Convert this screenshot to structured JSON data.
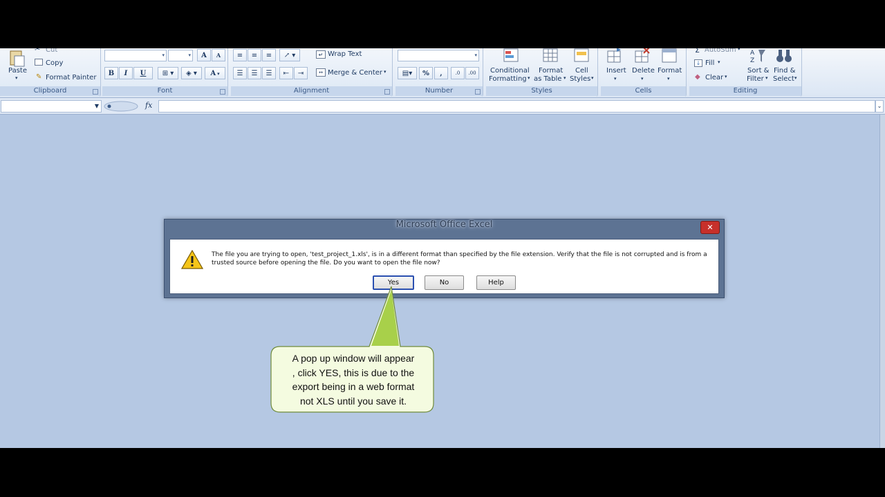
{
  "ribbon": {
    "clipboard": {
      "label": "Clipboard",
      "paste": "Paste",
      "cut": "Cut",
      "copy": "Copy",
      "format_painter": "Format Painter"
    },
    "font": {
      "label": "Font",
      "bold": "B",
      "italic": "I",
      "underline": "U",
      "grow": "A",
      "shrink": "A",
      "color": "A"
    },
    "alignment": {
      "label": "Alignment",
      "wrap_text": "Wrap Text",
      "merge_center": "Merge & Center"
    },
    "number": {
      "label": "Number",
      "percent": "%",
      "comma": ","
    },
    "styles": {
      "label": "Styles",
      "conditional_1": "Conditional",
      "conditional_2": "Formatting",
      "format_table_1": "Format",
      "format_table_2": "as Table",
      "cell_styles_1": "Cell",
      "cell_styles_2": "Styles"
    },
    "cells": {
      "label": "Cells",
      "insert": "Insert",
      "delete": "Delete",
      "format": "Format"
    },
    "editing": {
      "label": "Editing",
      "autosum": "AutoSum",
      "fill": "Fill",
      "clear": "Clear",
      "sort_1": "Sort &",
      "sort_2": "Filter",
      "find_1": "Find &",
      "find_2": "Select"
    }
  },
  "formula_bar": {
    "fx": "fx"
  },
  "dialog": {
    "title": "Microsoft Office Excel",
    "close": "✕",
    "message": "The file you are trying to open, 'test_project_1.xls', is in a different format than specified by the file extension. Verify that the file is not corrupted and is from a trusted source before opening the file. Do you want to open the file now?",
    "yes": "Yes",
    "no": "No",
    "help": "Help"
  },
  "callout": {
    "line1": "A pop up window will appear",
    "line2": ", click YES, this is due to the",
    "line3": "export being in a web format",
    "line4": "not XLS until you save it."
  },
  "colors": {
    "workspace": "#b5c8e3",
    "callout_fill": "#f4fbe0",
    "callout_border": "#6f8a3a",
    "callout_tail": "#a8d04a"
  }
}
